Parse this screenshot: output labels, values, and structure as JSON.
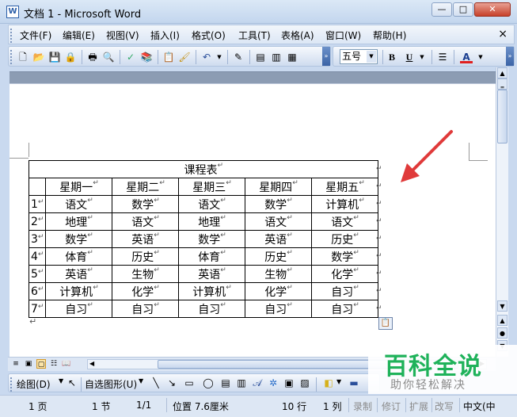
{
  "window": {
    "title": "文档 1 - Microsoft Word",
    "app_icon": "W"
  },
  "menu": {
    "items": [
      "文件(F)",
      "编辑(E)",
      "视图(V)",
      "插入(I)",
      "格式(O)",
      "工具(T)",
      "表格(A)",
      "窗口(W)",
      "帮助(H)"
    ],
    "close": "×"
  },
  "format": {
    "font_size": "五号",
    "bold": "B",
    "underline": "U",
    "font_color": "A"
  },
  "table": {
    "title": "课程表",
    "headers": [
      "",
      "星期一",
      "星期二",
      "星期三",
      "星期四",
      "星期五"
    ],
    "rows": [
      [
        "1",
        "语文",
        "数学",
        "语文",
        "数学",
        "计算机"
      ],
      [
        "2",
        "地理",
        "语文",
        "地理",
        "语文",
        "语文"
      ],
      [
        "3",
        "数学",
        "英语",
        "数学",
        "英语",
        "历史"
      ],
      [
        "4",
        "体育",
        "历史",
        "体育",
        "历史",
        "数学"
      ],
      [
        "5",
        "英语",
        "生物",
        "英语",
        "生物",
        "化学"
      ],
      [
        "6",
        "计算机",
        "化学",
        "计算机",
        "化学",
        "自习"
      ],
      [
        "7",
        "自习",
        "自习",
        "自习",
        "自习",
        "自习"
      ]
    ]
  },
  "drawing": {
    "draw_label": "绘图(D)",
    "autoshapes_label": "自选图形(U)"
  },
  "status": {
    "page": "1 页",
    "section": "1 节",
    "page_of": "1/1",
    "position": "位置 7.6厘米",
    "line": "10 行",
    "column": "1 列",
    "rec": "录制",
    "trk": "修订",
    "ext": "扩展",
    "ovr": "改写",
    "lang": "中文(中"
  },
  "watermark": {
    "title": "百科全说",
    "subtitle": "助你轻松解决"
  },
  "colors": {
    "accent": "#1fb25a",
    "arrow": "#e03a3a"
  }
}
